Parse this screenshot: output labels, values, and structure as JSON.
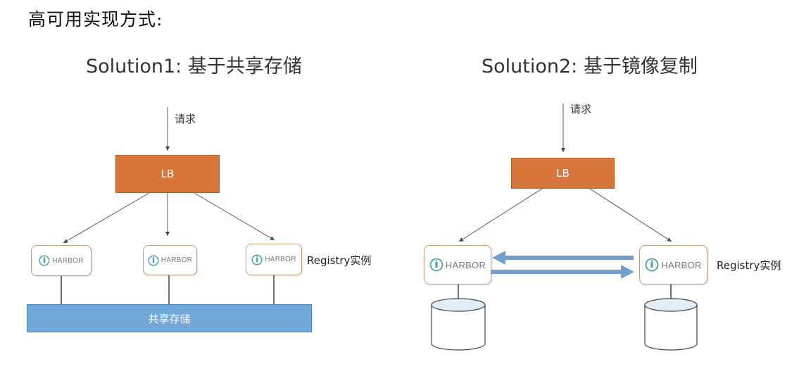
{
  "page": {
    "heading": "高可用实现方式:"
  },
  "solution1": {
    "title": "Solution1: 基于共享存储",
    "request_label": "请求",
    "lb_label": "LB",
    "harbor_label": "HARBOR",
    "registry_label": "Registry实例",
    "storage_label": "共享存储"
  },
  "solution2": {
    "title": "Solution2: 基于镜像复制",
    "request_label": "请求",
    "lb_label": "LB",
    "harbor_label": "HARBOR",
    "registry_label": "Registry实例"
  },
  "colors": {
    "lb": "#d9763c",
    "storage": "#6fa8d9",
    "replication_arrow": "#5b8fc7",
    "harbor_logo": "#4aa3a8"
  },
  "icons": {
    "harbor": "harbor-logo-icon",
    "database": "database-cylinder-icon"
  }
}
